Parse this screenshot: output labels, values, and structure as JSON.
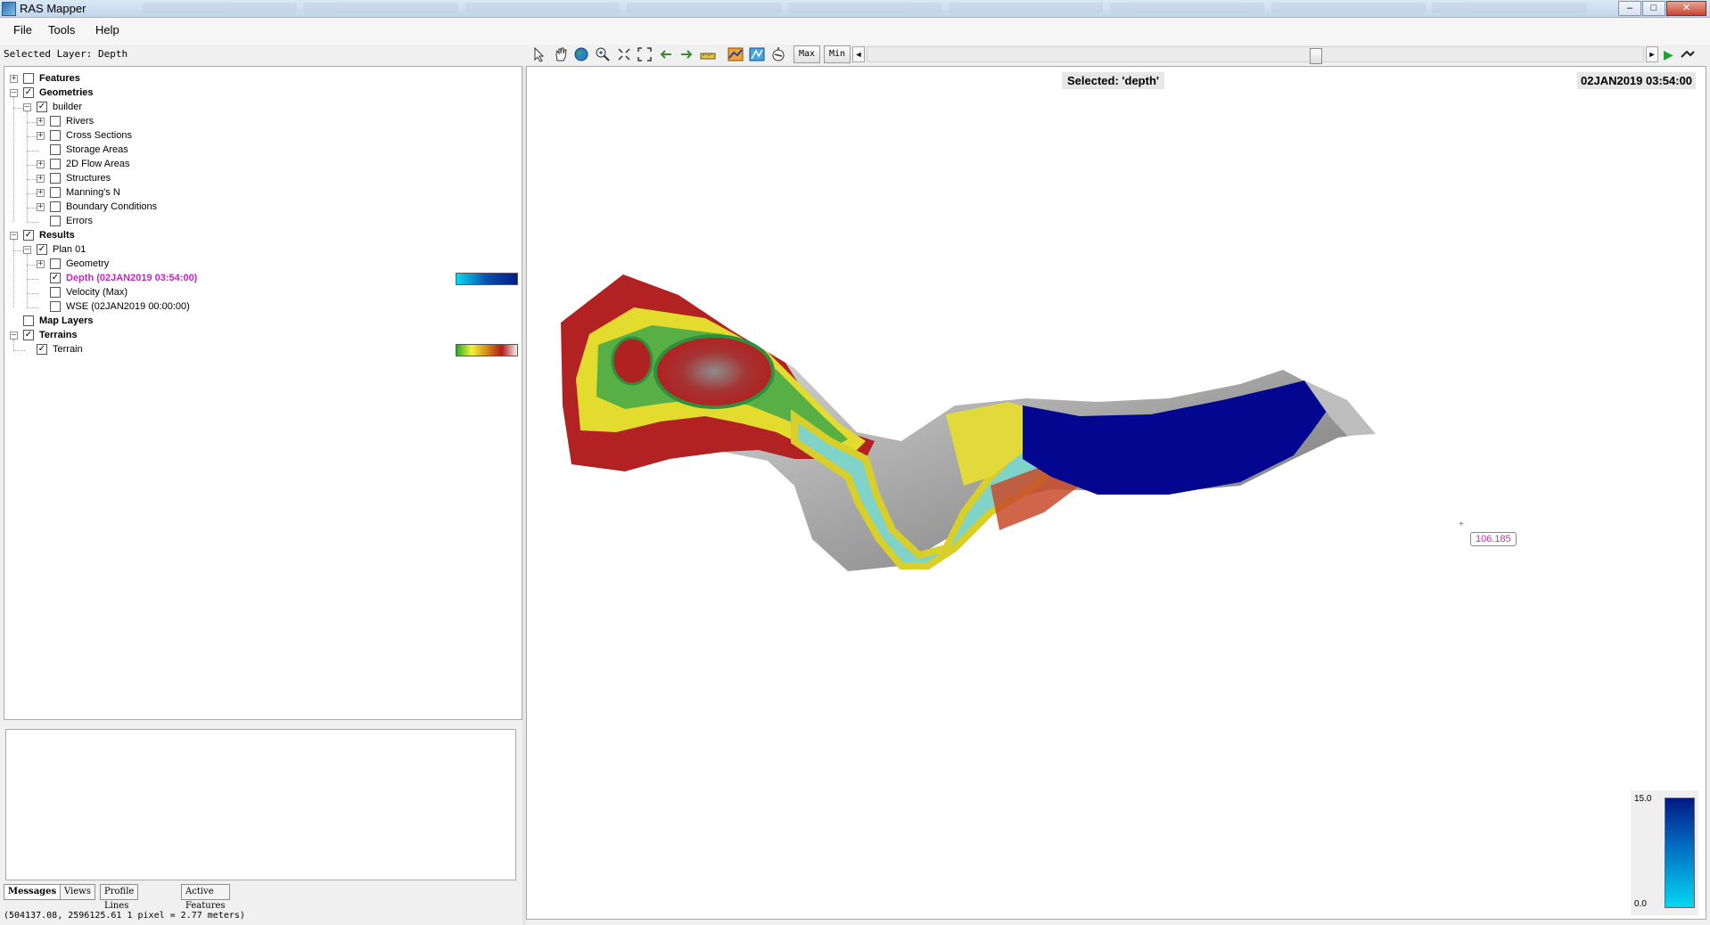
{
  "window": {
    "title": "RAS Mapper",
    "min_glyph": "–",
    "max_glyph": "□",
    "close_glyph": "✕"
  },
  "menu": [
    "File",
    "Tools",
    "Help"
  ],
  "selected_layer_label": "Selected Layer: Depth",
  "toolbar": {
    "icons": [
      "select-arrow-icon",
      "pan-hand-icon",
      "globe-icon",
      "zoom-in-icon",
      "zoom-extents-icon",
      "full-extent-icon",
      "back-arrow-icon",
      "forward-arrow-icon",
      "measure-ruler-icon",
      "profile-plot-icon",
      "map-layer-icon",
      "identify-icon"
    ],
    "max_label": "Max",
    "min_label": "Min",
    "left_arrow": "◄",
    "right_arrow": "►",
    "play_glyph": "▶",
    "time_slider_fraction": 0.58
  },
  "tree": [
    {
      "label": "Features",
      "bold": true,
      "checked": false
    },
    {
      "label": "Geometries",
      "bold": true,
      "checked": true
    },
    {
      "label": "builder",
      "checked": true
    },
    {
      "label": "Rivers",
      "checked": false
    },
    {
      "label": "Cross Sections",
      "checked": false
    },
    {
      "label": "Storage Areas",
      "checked": false
    },
    {
      "label": "2D Flow Areas",
      "checked": false
    },
    {
      "label": "Structures",
      "checked": false
    },
    {
      "label": "Manning's N",
      "checked": false
    },
    {
      "label": "Boundary Conditions",
      "checked": false
    },
    {
      "label": "Errors",
      "checked": false
    },
    {
      "label": "Results",
      "bold": true,
      "checked": true
    },
    {
      "label": "Plan 01",
      "checked": true
    },
    {
      "label": "Geometry",
      "checked": false
    },
    {
      "label": "Depth (02JAN2019 03:54:00)",
      "checked": true,
      "highlight": true
    },
    {
      "label": "Velocity (Max)",
      "checked": false
    },
    {
      "label": "WSE (02JAN2019 00:00:00)",
      "checked": false
    },
    {
      "label": "Map Layers",
      "bold": true,
      "checked": false
    },
    {
      "label": "Terrains",
      "bold": true,
      "checked": true
    },
    {
      "label": "Terrain",
      "checked": true
    }
  ],
  "tree_colors": {
    "highlight": "#c226c2",
    "depth_ramp": [
      "#0ad8f0",
      "#0a4fb0",
      "#041d86"
    ],
    "terrain_ramp": [
      "#2ca82c",
      "#f2f23a",
      "#d48a1a",
      "#b41a1a",
      "#f2f2f2"
    ]
  },
  "bottom_tabs": [
    "Messages",
    "Views",
    "Profile Lines",
    "Active Features"
  ],
  "status": "(504137.08, 2596125.61  1 pixel = 2.77 meters)",
  "map": {
    "selected_banner": "Selected: 'depth'",
    "time_display": "02JAN2019 03:54:00",
    "probe_value": "106.185",
    "probe_cross": "+",
    "legend": {
      "max": "15.0",
      "min": "0.0",
      "colors": [
        "#021a85",
        "#0078c8",
        "#06d7f2"
      ]
    },
    "colors": {
      "depth_fill": "#03068f",
      "terrain_high": "#b31e1e",
      "terrain_mid": "#e7e12e",
      "terrain_low": "#2aa34a",
      "channel": "#7ed3c8",
      "hillshade": "#9a9a9a"
    }
  }
}
